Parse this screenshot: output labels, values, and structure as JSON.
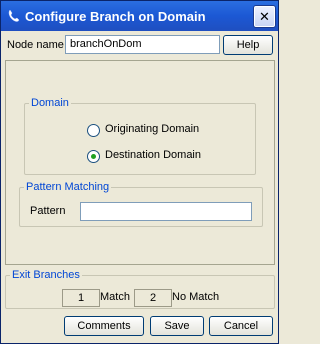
{
  "window": {
    "title": "Configure Branch on Domain"
  },
  "node": {
    "label": "Node name",
    "value": "branchOnDom",
    "help_label": "Help"
  },
  "domain": {
    "legend": "Domain",
    "options": [
      {
        "label": "Originating Domain",
        "checked": false
      },
      {
        "label": "Destination Domain",
        "checked": true
      }
    ]
  },
  "pattern": {
    "legend": "Pattern Matching",
    "label": "Pattern",
    "value": ""
  },
  "exits": {
    "legend": "Exit Branches",
    "match_count": "1",
    "match_label": "Match",
    "nomatch_count": "2",
    "nomatch_label": "No Match"
  },
  "buttons": {
    "comments": "Comments",
    "save": "Save",
    "cancel": "Cancel"
  },
  "colors": {
    "titlebar": "#1c58d4",
    "legend_text": "#0046d5",
    "background": "#ece9d8"
  }
}
